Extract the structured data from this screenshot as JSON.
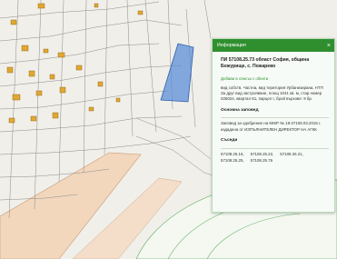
{
  "panel": {
    "header": "Информация",
    "close": "×",
    "title": "ПИ 57108.25.73 област София, община Божурище, с. Пожарево",
    "link": "Добави в списък с обекти",
    "description": "вид собств. Частна, вид територия Урбанизирана, НТП За друг вид застрояване, площ 1041 кв. м, стар номер 025024, квартал 61, парцел I, брой върхове: 9 бр.",
    "plan_heading": "Основна заповед",
    "plan_text": "Заповед за одобрение на КККР № 18-27108.03.2016 г. издадена от ИЗПЪЛНИТЕЛЕН ДИРЕКТОР НА АГКК",
    "neighbors_heading": "Съседи",
    "neighbors": [
      "57108.25.16,",
      "57108.25.22,",
      "57108.25.21,",
      "57108.25.25,",
      "57108.25.76"
    ]
  },
  "colors": {
    "header": "#2f8f2f",
    "selected_parcel": "#5b8fd8",
    "building": "#e0a832",
    "road": "#f2d7bd"
  }
}
